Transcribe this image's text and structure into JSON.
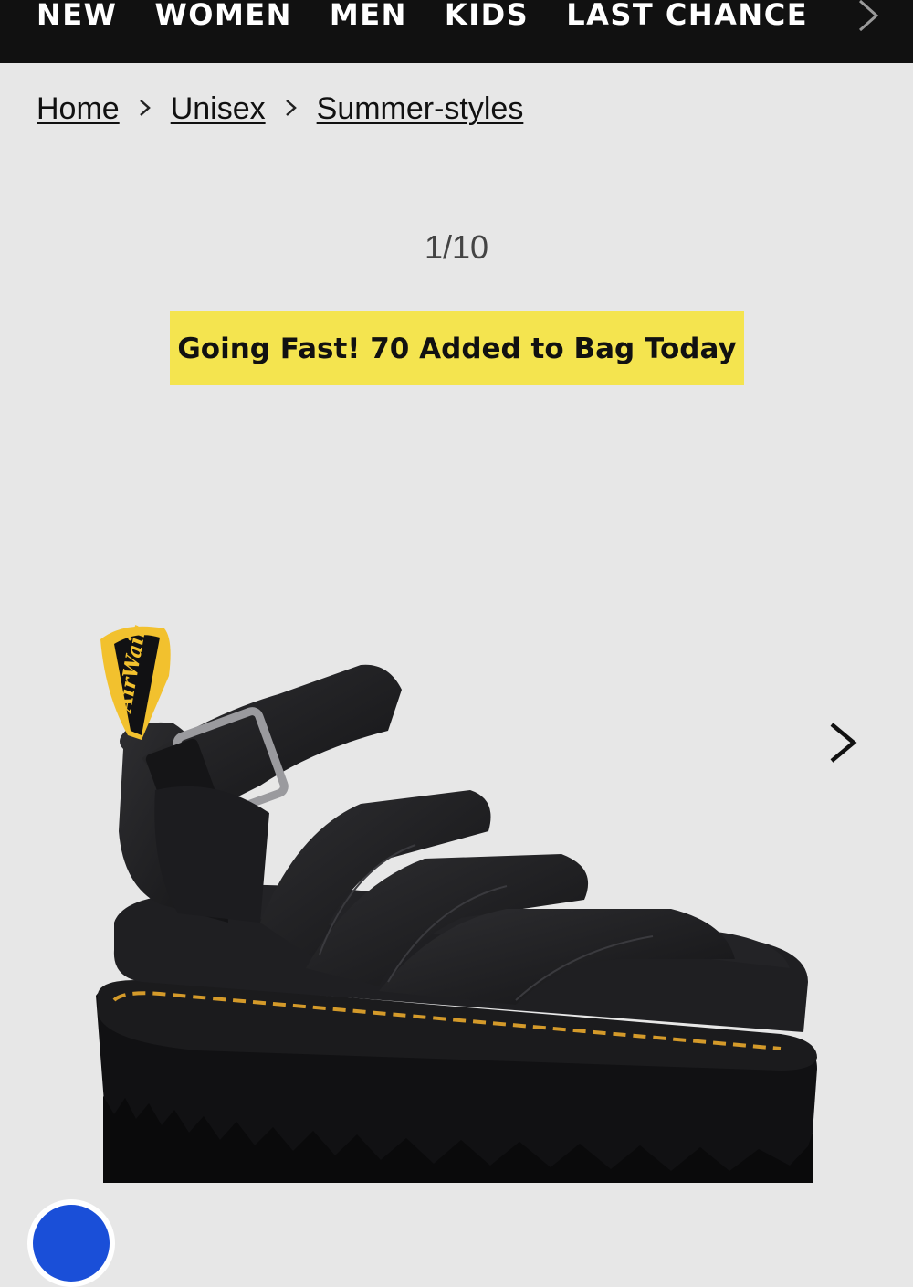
{
  "nav": {
    "items": [
      "NEW",
      "WOMEN",
      "MEN",
      "KIDS",
      "LAST CHANCE"
    ],
    "next_icon": "chevron-right-icon"
  },
  "breadcrumb": {
    "items": [
      "Home",
      "Unisex",
      "Summer-styles"
    ],
    "separator_icon": "chevron-right-icon"
  },
  "gallery": {
    "counter": "1/10",
    "next_icon": "chevron-right-icon"
  },
  "badge": {
    "text": "Going Fast! 70 Added to Bag Today",
    "color": "#f4e44f"
  },
  "product_image": {
    "icon": "sandal-product-image",
    "heel_loop_text": "AirWair",
    "colors": {
      "leather": "#1c1c1e",
      "stitch": "#d49a2a",
      "loop": "#f2c12e"
    }
  },
  "chat": {
    "icon": "chat-widget-icon",
    "color": "#1a4fd8"
  },
  "colors": {
    "nav_bg": "#111111",
    "page_bg": "#e7e7e7"
  }
}
